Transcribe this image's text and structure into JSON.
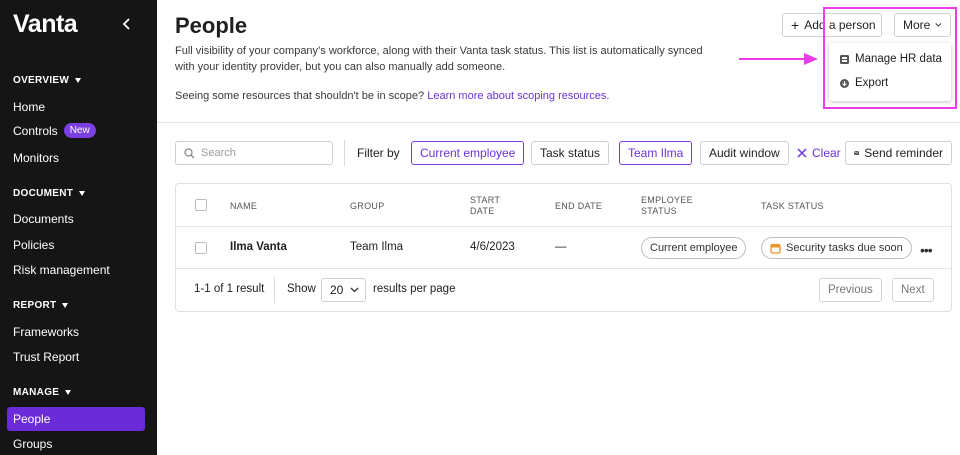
{
  "sidebar": {
    "logo": "Vanta",
    "sections": [
      {
        "label": "OVERVIEW",
        "items": [
          {
            "label": "Home"
          },
          {
            "label": "Controls",
            "badge": "New"
          },
          {
            "label": "Monitors"
          }
        ]
      },
      {
        "label": "DOCUMENT",
        "items": [
          {
            "label": "Documents"
          },
          {
            "label": "Policies"
          },
          {
            "label": "Risk management"
          }
        ]
      },
      {
        "label": "REPORT",
        "items": [
          {
            "label": "Frameworks"
          },
          {
            "label": "Trust Report"
          }
        ]
      },
      {
        "label": "MANAGE",
        "items": [
          {
            "label": "People",
            "active": true
          },
          {
            "label": "Groups"
          }
        ]
      }
    ]
  },
  "header": {
    "title": "People",
    "description": "Full visibility of your company’s workforce, along with their Vanta task status. This list is automatically synced with your identity provider, but you can also manually add someone.",
    "scope_text": "Seeing some resources that shouldn't be in scope?",
    "scope_link": "Learn more about scoping resources.",
    "add_person_label": "Add a person",
    "more_label": "More"
  },
  "more_menu": {
    "items": [
      {
        "label": "Manage HR data",
        "icon": "hr-data-icon"
      },
      {
        "label": "Export",
        "icon": "export-icon"
      }
    ]
  },
  "filters": {
    "search_placeholder": "Search",
    "filter_by_label": "Filter by",
    "chips": [
      {
        "label": "Current employee",
        "active": true
      },
      {
        "label": "Task status",
        "active": false
      },
      {
        "label": "Team Ilma",
        "active": true
      },
      {
        "label": "Audit window",
        "active": false
      }
    ],
    "clear_label": "Clear",
    "send_reminder_label": "Send reminder"
  },
  "table": {
    "headers": {
      "name": "NAME",
      "group": "GROUP",
      "start_date": "START DATE",
      "end_date": "END DATE",
      "employee_status": "EMPLOYEE STATUS",
      "task_status": "TASK STATUS"
    },
    "rows": [
      {
        "name": "Ilma Vanta",
        "group": "Team Ilma",
        "start_date": "4/6/2023",
        "end_date": "—",
        "employee_status": "Current employee",
        "task_status": "Security tasks due soon"
      }
    ],
    "footer": {
      "result_count": "1-1 of 1 result",
      "show_label": "Show",
      "per_page_value": "20",
      "per_page_suffix": "results per page",
      "previous_label": "Previous",
      "next_label": "Next"
    }
  },
  "colors": {
    "sidebar_bg": "#151515",
    "accent": "#6c2bd9",
    "highlight": "#e83de8",
    "warning": "#e8952a"
  }
}
